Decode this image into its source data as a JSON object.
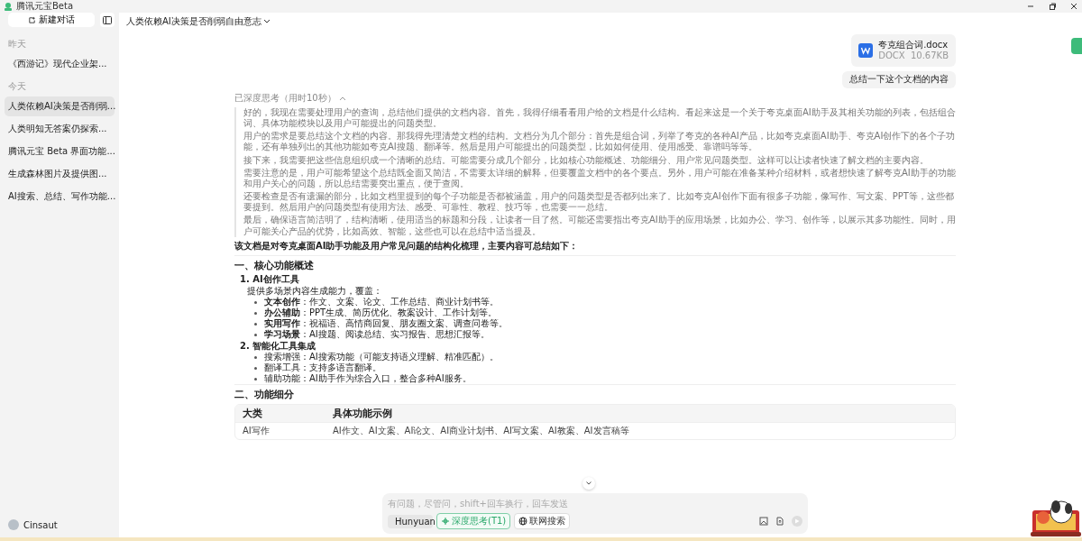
{
  "window": {
    "title": "腾讯元宝Beta"
  },
  "sidebar": {
    "new_chat": "新建对话",
    "groups": [
      {
        "label": "昨天",
        "items": [
          {
            "label": "《西游记》现代企业架...",
            "selected": false
          }
        ]
      },
      {
        "label": "今天",
        "items": [
          {
            "label": "人类依赖AI决策是否削弱...",
            "selected": true
          },
          {
            "label": "人类明知无答案仍探索...",
            "selected": false
          },
          {
            "label": "腾讯元宝 Beta 界面功能...",
            "selected": false
          },
          {
            "label": "生成森林图片及提供图...",
            "selected": false
          },
          {
            "label": "AI搜索、总结、写作功能...",
            "selected": false
          }
        ]
      }
    ],
    "user": "Cinsaut"
  },
  "header": {
    "title": "人类依赖AI决策是否削弱自由意志"
  },
  "chat": {
    "attachment": {
      "name": "夸克组合词.docx",
      "type": "DOCX",
      "size": "10.67KB"
    },
    "user_message": "总结一下这个文档的内容",
    "thinking": {
      "label": "已深度思考（用时10秒）",
      "expanded": true,
      "paragraphs": [
        "好的，我现在需要处理用户的查询，总结他们提供的文档内容。首先，我得仔细看看用户给的文档是什么结构。看起来这是一个关于夸克桌面AI助手及其相关功能的列表，包括组合词、具体功能模块以及用户可能提出的问题类型。",
        "用户的需求是要总结这个文档的内容。那我得先理清楚文档的结构。文档分为几个部分：首先是组合词，列举了夸克的各种AI产品，比如夸克桌面AI助手、夸克AI创作下的各个子功能，还有单独列出的其他功能如夸克AI搜题、翻译等。然后是用户可能提出的问题类型，比如如何使用、使用感受、靠谱吗等等。",
        "接下来，我需要把这些信息组织成一个清晰的总结。可能需要分成几个部分，比如核心功能概述、功能细分、用户常见问题类型。这样可以让读者快速了解文档的主要内容。",
        "需要注意的是，用户可能希望这个总结既全面又简洁，不需要太详细的解释，但要覆盖文档中的各个要点。另外，用户可能在准备某种介绍材料，或者想快速了解夸克AI助手的功能和用户关心的问题，所以总结需要突出重点，便于查阅。",
        "还要检查是否有遗漏的部分，比如文档里提到的每个子功能是否都被涵盖，用户的问题类型是否都列出来了。比如夸克AI创作下面有很多子功能，像写作、写文案、PPT等，这些都要提到。然后用户的问题类型有使用方法、感受、可靠性、教程、技巧等，也需要一一总结。",
        "最后，确保语言简洁明了，结构清晰，使用适当的标题和分段，让读者一目了然。可能还需要指出夸克AI助手的应用场景，比如办公、学习、创作等，以展示其多功能性。同时，用户可能关心产品的优势，比如高效、智能，这些也可以在总结中适当提及。"
      ]
    },
    "answer": {
      "intro": "该文档是对夸克桌面AI助手功能及用户常见问题的结构化梳理，主要内容可总结如下：",
      "sections": [
        {
          "heading": "一、核心功能概述",
          "groups": [
            {
              "title": "1. AI创作工具",
              "description": "提供多场景内容生成能力，覆盖：",
              "bullets": [
                "**文本创作**：作文、文案、论文、工作总结、商业计划书等。",
                "**办公辅助**：PPT生成、简历优化、教案设计、工作计划等。",
                "**实用写作**：祝福语、高情商回复、朋友圈文案、调查问卷等。",
                "**学习场景**：AI搜题、阅读总结、实习报告、思想汇报等。"
              ]
            },
            {
              "title": "2. 智能化工具集成",
              "bullets": [
                "搜索增强：AI搜索功能（可能支持语义理解、精准匹配）。",
                "翻译工具：支持多语言翻译。",
                "辅助功能：AI助手作为综合入口，整合多种AI服务。"
              ]
            }
          ]
        },
        {
          "heading": "二、功能细分",
          "table": {
            "columns": [
              "大类",
              "具体功能示例"
            ],
            "rows": [
              [
                "AI写作",
                "AI作文、AI文案、AI论文、AI商业计划书、AI写文案、AI教案、AI发言稿等"
              ]
            ]
          }
        }
      ]
    }
  },
  "composer": {
    "placeholder": "有问题，尽管问，shift+回车换行，回车发送",
    "model": "Hunyuan",
    "toggles": [
      {
        "label": "深度思考(T1)",
        "selected": true
      },
      {
        "label": "联网搜索",
        "selected": false
      }
    ],
    "send_disabled": true
  }
}
